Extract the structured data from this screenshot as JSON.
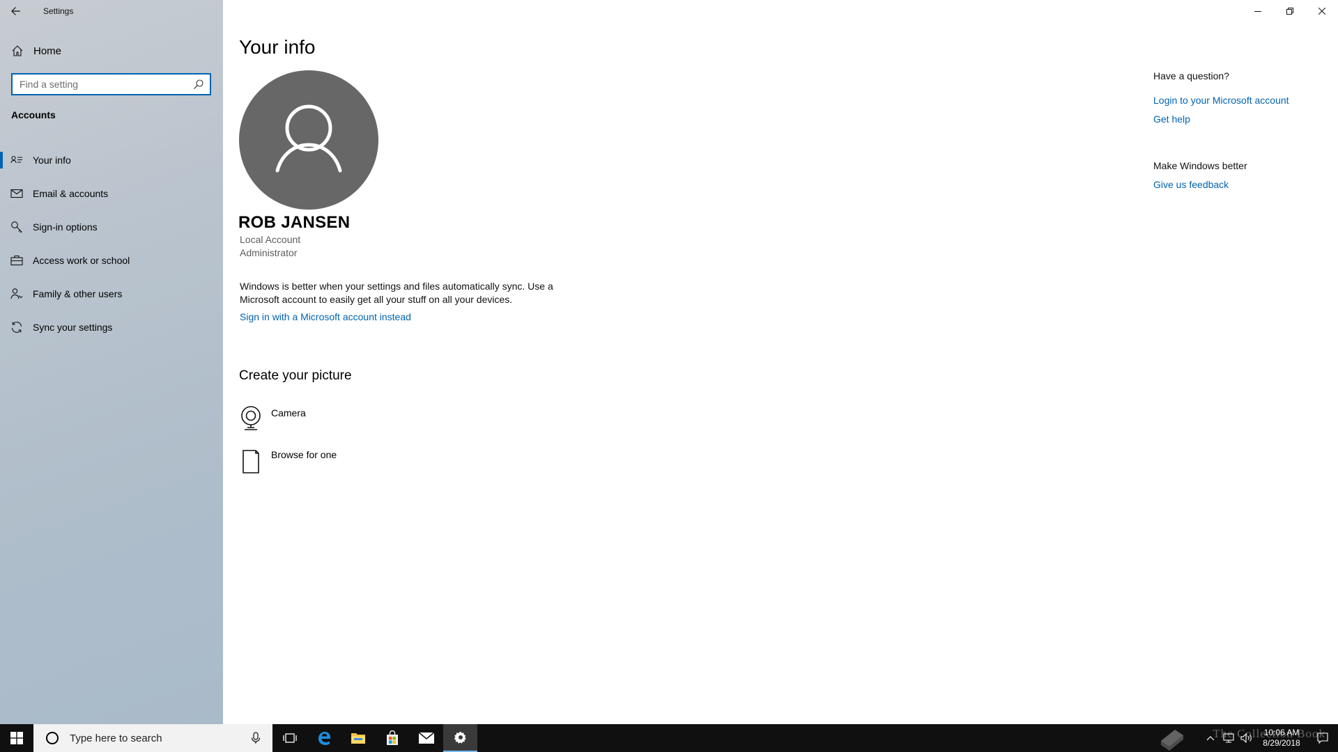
{
  "window": {
    "title": "Settings"
  },
  "sidebar": {
    "home_label": "Home",
    "search_placeholder": "Find a setting",
    "section_title": "Accounts",
    "items": [
      {
        "label": "Your info",
        "icon": "contact-card-icon",
        "active": true
      },
      {
        "label": "Email & accounts",
        "icon": "mail-icon",
        "active": false
      },
      {
        "label": "Sign-in options",
        "icon": "key-icon",
        "active": false
      },
      {
        "label": "Access work or school",
        "icon": "briefcase-icon",
        "active": false
      },
      {
        "label": "Family & other users",
        "icon": "people-icon",
        "active": false
      },
      {
        "label": "Sync your settings",
        "icon": "sync-icon",
        "active": false
      }
    ]
  },
  "main": {
    "page_title": "Your info",
    "user_name": "ROB JANSEN",
    "account_type": "Local Account",
    "account_role": "Administrator",
    "sync_message": "Windows is better when your settings and files automatically sync. Use a Microsoft account to easily get all your stuff on all your devices.",
    "ms_signin_link": "Sign in with a Microsoft account instead",
    "create_picture_title": "Create your picture",
    "picture_options": [
      {
        "label": "Camera",
        "icon": "camera-icon"
      },
      {
        "label": "Browse for one",
        "icon": "document-icon"
      }
    ]
  },
  "side_panel": {
    "question_heading": "Have a question?",
    "login_link": "Login to your Microsoft account",
    "help_link": "Get help",
    "better_heading": "Make Windows better",
    "feedback_link": "Give us feedback"
  },
  "taskbar": {
    "search_placeholder": "Type here to search",
    "time": "10:06 AM",
    "date": "8/29/2018",
    "watermark": "The Collection Book"
  },
  "colors": {
    "accent": "#0063b1",
    "avatar_bg": "#676767",
    "taskbar_bg": "#101010"
  }
}
